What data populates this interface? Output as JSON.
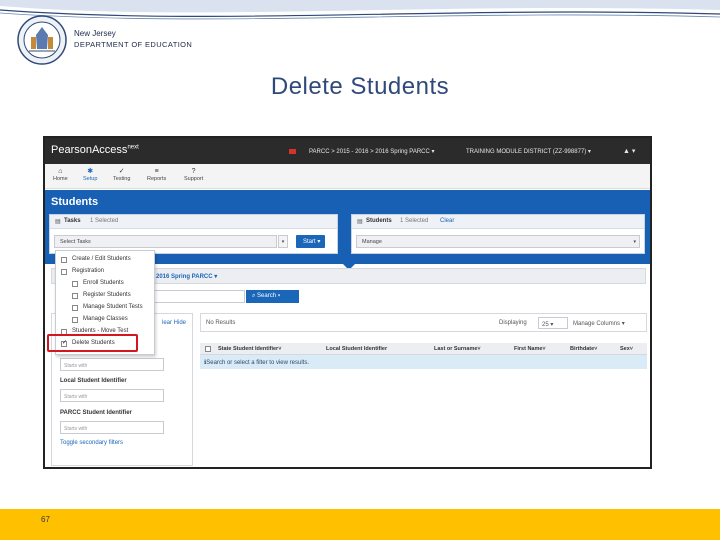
{
  "header": {
    "state": "New Jersey",
    "department": "DEPARTMENT OF EDUCATION",
    "slide_title": "Delete Students"
  },
  "app": {
    "brand": "PearsonAccess",
    "brand_sup": "next",
    "breadcrumb": "PARCC > 2015 - 2016 > 2016 Spring PARCC ▾",
    "district": "TRAINING MODULE DISTRICT (ZZ-998877) ▾",
    "user_menu": "▲ ▾"
  },
  "nav": [
    {
      "label": "Home",
      "icon": "home-icon",
      "glyph": "⌂"
    },
    {
      "label": "Setup",
      "icon": "gear-icon",
      "glyph": "✱"
    },
    {
      "label": "Testing",
      "icon": "check-icon",
      "glyph": "✓"
    },
    {
      "label": "Reports",
      "icon": "list-icon",
      "glyph": "≡"
    },
    {
      "label": "Support",
      "icon": "help-icon",
      "glyph": "?"
    }
  ],
  "page": {
    "heading": "Students"
  },
  "tasks_panel": {
    "title": "Tasks",
    "selected": "1 Selected",
    "select_placeholder": "Select Tasks",
    "start_label": "Start ▾"
  },
  "students_panel": {
    "title": "Students",
    "selected": "1 Selected",
    "clear": "Clear",
    "manage_label": "Manage"
  },
  "admin": {
    "label": "2016 Spring PARCC ▾"
  },
  "search": {
    "button_label": "Search ▾"
  },
  "task_menu": [
    {
      "label": "Create / Edit Students",
      "indent": 0,
      "checked": false
    },
    {
      "label": "Registration",
      "indent": 0,
      "checked": false
    },
    {
      "label": "Enroll Students",
      "indent": 1,
      "checked": false
    },
    {
      "label": "Register Students",
      "indent": 1,
      "checked": false
    },
    {
      "label": "Manage Student Tests",
      "indent": 1,
      "checked": false
    },
    {
      "label": "Manage Classes",
      "indent": 1,
      "checked": false
    },
    {
      "label": "Students - Move Test",
      "indent": 0,
      "checked": false
    },
    {
      "label": "Delete Students",
      "indent": 0,
      "checked": true
    }
  ],
  "filters": {
    "clear_hide": "lear  Hide",
    "starts_with": "Starts with",
    "local_label": "Local Student Identifier",
    "parcc_label": "PARCC Student Identifier",
    "toggle": "Toggle secondary filters"
  },
  "results": {
    "no_results": "No Results",
    "displaying": "Displaying",
    "page_size": "25 ▾",
    "manage_columns": "Manage Columns ▾",
    "columns": [
      "State Student Identifier˅",
      "Local Student Identifier",
      "Last or Surname˅",
      "First Name˅",
      "Birthdate˅",
      "Sex˅"
    ],
    "info": "ℹSearch or select a filter to view results."
  },
  "footer": {
    "page_number": "67"
  },
  "colors": {
    "accent_blue": "#1860b3",
    "footer_yellow": "#ffc000",
    "highlight_red": "#d4161e"
  }
}
